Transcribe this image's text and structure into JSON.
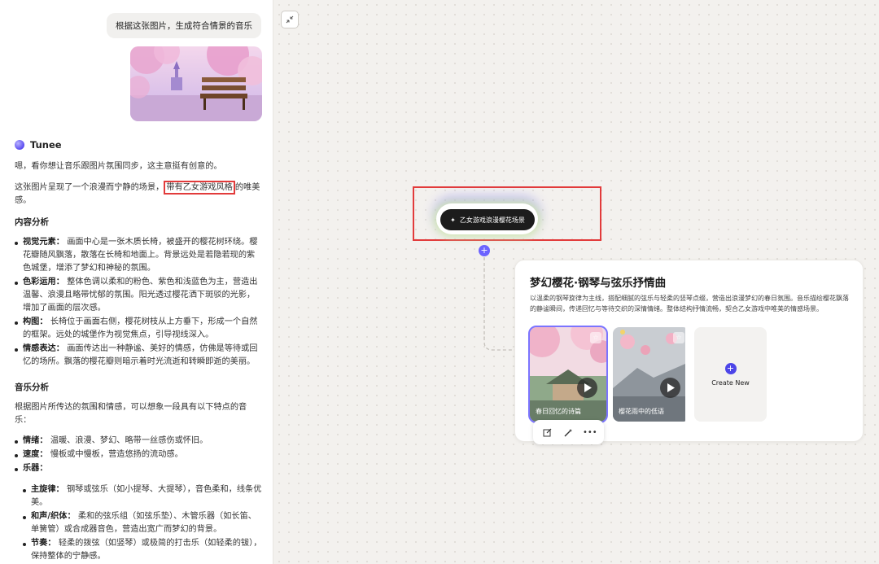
{
  "chat": {
    "user_prompt": "根据这张图片，生成符合情景的音乐",
    "assistant_name": "Tunee",
    "intro": "嗯，看你想让音乐跟图片氛围同步，这主意挺有创意的。",
    "desc_before": "这张图片呈现了一个浪漫而宁静的场景，",
    "desc_highlight": "带有乙女游戏风格",
    "desc_after": "的唯美感。",
    "content_heading": "内容分析",
    "content_items": [
      {
        "key": "视觉元素：",
        "text": "画面中心是一张木质长椅，被盛开的樱花树环绕。樱花瓣随风飘落，散落在长椅和地面上。背景远处是若隐若现的紫色城堡，增添了梦幻和神秘的氛围。"
      },
      {
        "key": "色彩运用：",
        "text": "整体色调以柔和的粉色、紫色和浅蓝色为主，营造出温馨、浪漫且略带忧郁的氛围。阳光透过樱花洒下斑驳的光影，增加了画面的层次感。"
      },
      {
        "key": "构图：",
        "text": "长椅位于画面右侧，樱花树枝从上方垂下，形成一个自然的框架。远处的城堡作为视觉焦点，引导视线深入。"
      },
      {
        "key": "情感表达：",
        "text": "画面传达出一种静谧、美好的情感，仿佛是等待或回忆的场所。飘落的樱花瓣则暗示着时光流逝和转瞬即逝的美丽。"
      }
    ],
    "music_heading": "音乐分析",
    "music_intro": "根据图片所传达的氛围和情感，可以想象一段具有以下特点的音乐：",
    "music_items": [
      {
        "key": "情绪：",
        "text": "温暖、浪漫、梦幻、略带一丝感伤或怀旧。"
      },
      {
        "key": "速度：",
        "text": "慢板或中慢板，营造悠扬的流动感。"
      },
      {
        "key": "乐器：",
        "text": ""
      }
    ],
    "instrument_items": [
      {
        "key": "主旋律：",
        "text": "钢琴或弦乐（如小提琴、大提琴），音色柔和，线条优美。"
      },
      {
        "key": "和声/织体：",
        "text": "柔和的弦乐组（如弦乐垫）、木管乐器（如长笛、单簧管）或合成器音色，营造出宽广而梦幻的背景。"
      },
      {
        "key": "节奏：",
        "text": "轻柔的拨弦（如竖琴）或极简的打击乐（如轻柔的钹），保持整体的宁静感。"
      }
    ]
  },
  "canvas": {
    "node_label": "乙女游戏浪漫樱花场景",
    "result": {
      "title": "梦幻樱花·钢琴与弦乐抒情曲",
      "description": "以温柔的钢琴旋律为主线，搭配细腻的弦乐与轻柔的竖琴点缀，营造出浪漫梦幻的春日氛围。音乐描绘樱花飘落的静谧瞬间，传递回忆与等待交织的深情情绪。整体结构抒情流畅，契合乙女游戏中唯美的情感场景。",
      "tracks": [
        {
          "title": "春日回忆的诗篇",
          "selected": true
        },
        {
          "title": "樱花雨中的低语",
          "selected": false
        }
      ],
      "create_new_label": "Create New"
    }
  },
  "colors": {
    "accent": "#6c63ff",
    "highlight_frame": "#e23b3b"
  }
}
